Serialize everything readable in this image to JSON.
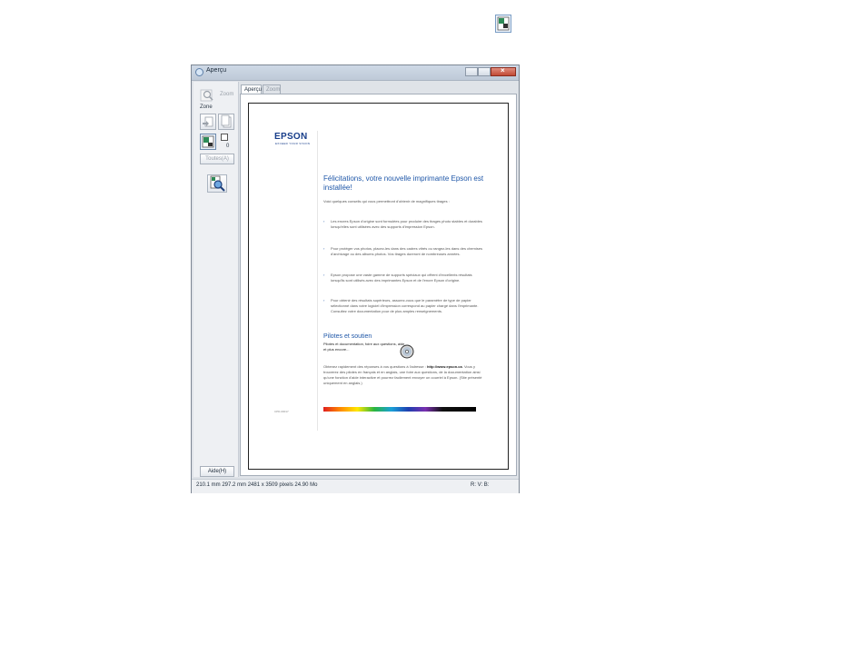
{
  "window": {
    "title": "Aperçu"
  },
  "left_panel": {
    "zoom_label": "Zoom",
    "zone_label": "Zone",
    "count": "0",
    "all_label": "Toutes(A)",
    "help_label": "Aide(H)"
  },
  "tabs": [
    {
      "label": "Aperçu",
      "active": true
    },
    {
      "label": "Zoom",
      "active": false
    }
  ],
  "document": {
    "logo": "EPSON",
    "tagline": "EXCEED YOUR VISION",
    "title": "Félicitations, votre nouvelle imprimante Epson est installée!",
    "intro": "Voici quelques conseils qui vous permettront d'obtenir de magnifiques tirages :",
    "bullets": [
      "Les encres Epson d'origine sont formulées pour produire des tirages photo stables et durables lorsqu'elles sont utilisées avec des supports d'impression Epson.",
      "Pour protéger vos photos, placez-les dans des cadres vitrés ou rangez-les dans des chemises d'archivage ou des albums photos. Vos tirages dureront de nombreuses années.",
      "Epson propose une vaste gamme de supports spéciaux qui offrent d'excellents résultats lorsqu'ils sont utilisés avec des imprimantes Epson et de l'encre Epson d'origine.",
      "Pour obtenir des résultats supérieurs, assurez-vous que le paramètre de type de papier sélectionné dans votre logiciel d'impression correspond au papier chargé dans l'imprimante. Consultez votre documentation pour de plus amples renseignements."
    ],
    "section_title": "Pilotes et soutien",
    "section_subtitle": "Pilotes et documentation, foire aux questions, aide et plus encore...",
    "contact_intro": "Obtenez rapidement des réponses à vos questions à l'adresse :",
    "contact_url": "http://www.epson.ca",
    "contact_rest": ". Vous y trouverez des pilotes en français et en anglais, une foire aux questions, de la documentation ainsi qu'une fonction d'aide interactive et pourrez facilement envoyer un courriel à Epson. (Site présenté uniquement en anglais.)",
    "code": "CPD-00017"
  },
  "status": {
    "left": "210.1 mm  297.2 mm  2481 x 3509 pixels 24.90 Mo",
    "right": "R: V: B:"
  }
}
